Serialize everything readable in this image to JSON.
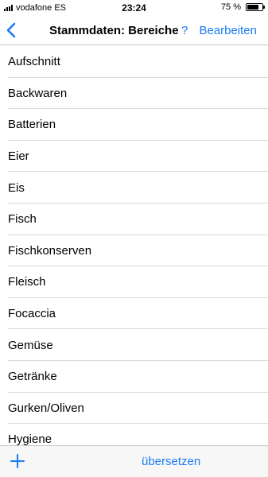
{
  "status_bar": {
    "carrier": "vodafone ES",
    "time": "23:24",
    "battery_percent": "75 %",
    "battery_level": 0.75
  },
  "nav": {
    "back_icon": "chevron-left-icon",
    "title": "Stammdaten: Bereiche",
    "help_label": "?",
    "edit_label": "Bearbeiten"
  },
  "list": {
    "items": [
      {
        "label": "Aufschnitt"
      },
      {
        "label": "Backwaren"
      },
      {
        "label": "Batterien"
      },
      {
        "label": "Eier"
      },
      {
        "label": "Eis"
      },
      {
        "label": "Fisch"
      },
      {
        "label": "Fischkonserven"
      },
      {
        "label": "Fleisch"
      },
      {
        "label": "Focaccia"
      },
      {
        "label": "Gemüse"
      },
      {
        "label": "Getränke"
      },
      {
        "label": "Gurken/Oliven"
      },
      {
        "label": "Hygiene"
      }
    ]
  },
  "toolbar": {
    "add_icon": "plus-icon",
    "translate_label": "übersetzen"
  },
  "colors": {
    "accent": "#1a7cf5",
    "separator": "#d9d9dc",
    "toolbar_bg": "#f7f7f7"
  }
}
